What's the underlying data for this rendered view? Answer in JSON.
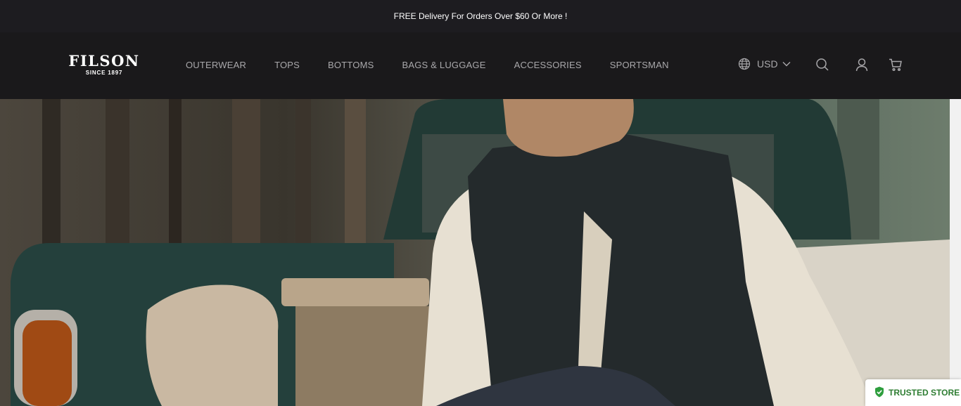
{
  "announcement": {
    "text": "FREE Delivery For Orders Over $60 Or More !"
  },
  "header": {
    "logo": {
      "name": "FILSON",
      "since": "SINCE 1897"
    },
    "nav": [
      {
        "label": "OUTERWEAR"
      },
      {
        "label": "TOPS"
      },
      {
        "label": "BOTTOMS"
      },
      {
        "label": "BAGS & LUGGAGE"
      },
      {
        "label": "ACCESSORIES"
      },
      {
        "label": "SPORTSMAN"
      }
    ],
    "currency": {
      "code": "USD",
      "icon": "globe-icon"
    },
    "icons": [
      "search-icon",
      "account-icon",
      "cart-icon"
    ]
  },
  "badge": {
    "label": "TRUSTED STORE",
    "icon": "shield-check-icon",
    "color": "#2e7d32"
  },
  "colors": {
    "header_bg": "#1a191b",
    "announce_bg": "#1d1c20",
    "nav_text": "#a9a8ab"
  }
}
